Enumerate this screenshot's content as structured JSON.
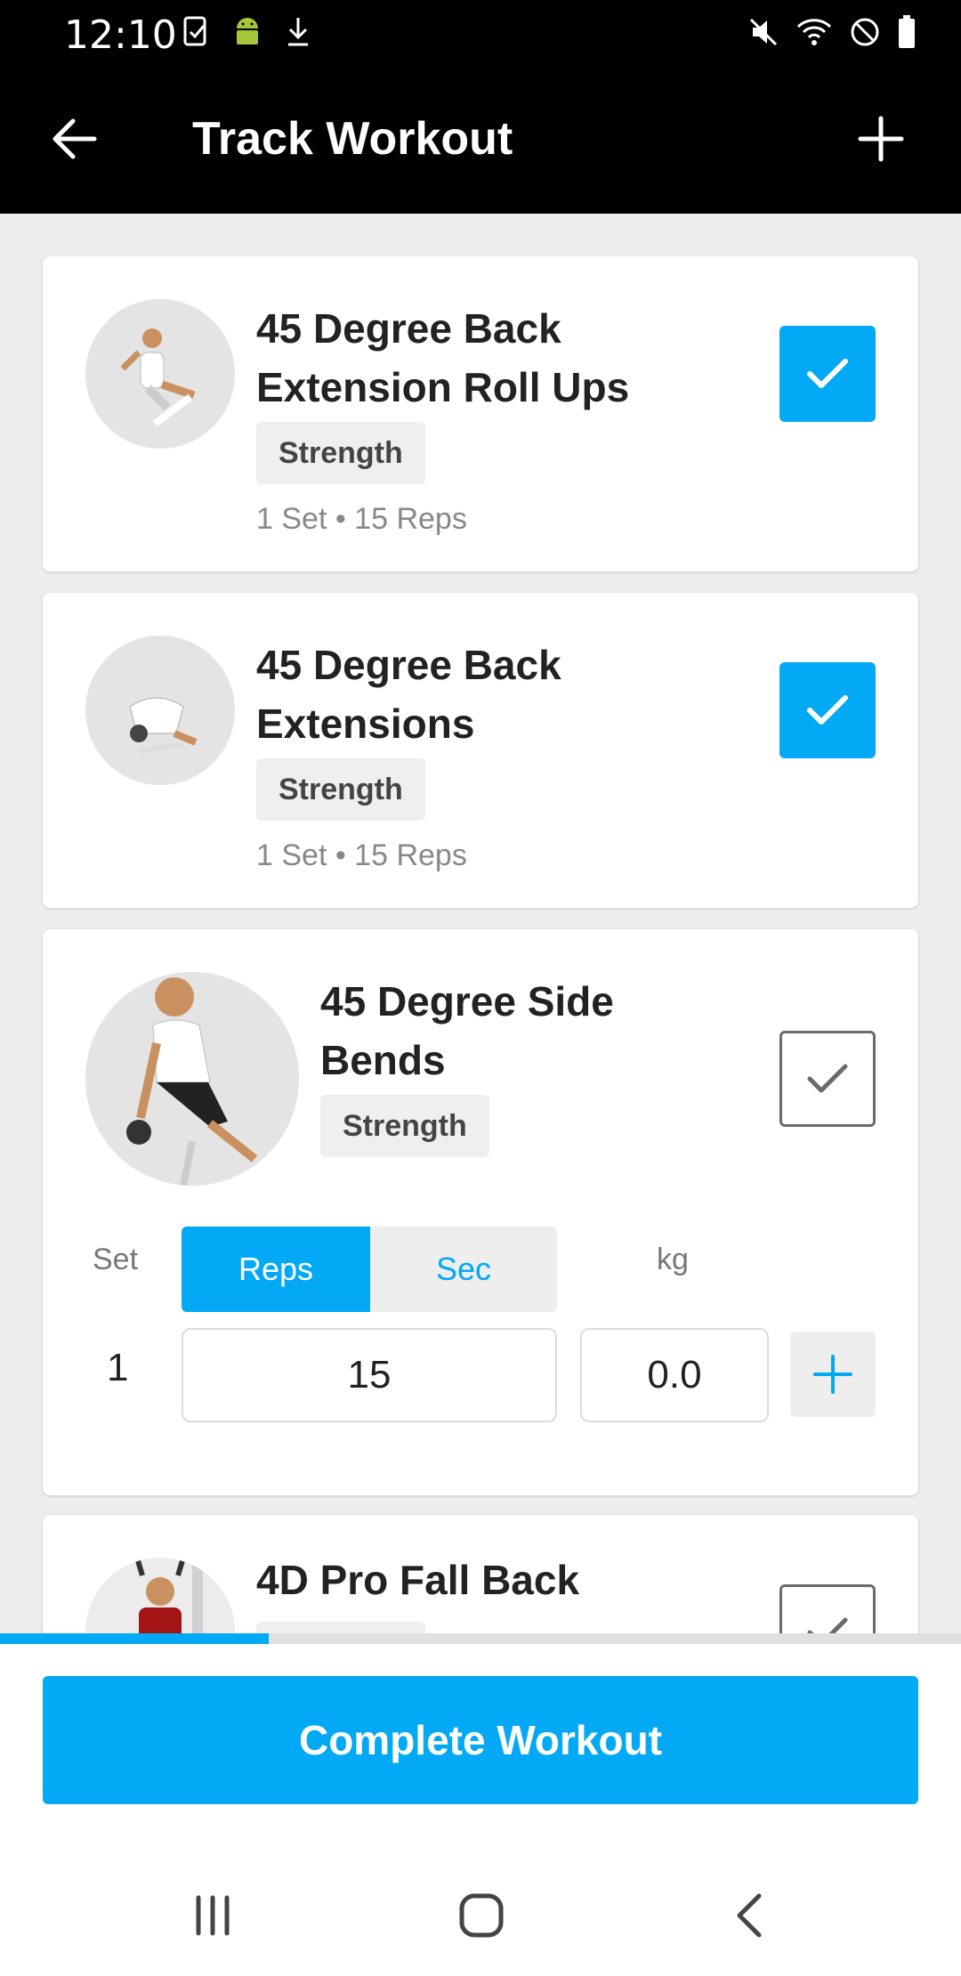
{
  "status_bar": {
    "time": "12:10",
    "left_icons": [
      "checklist-icon",
      "android-icon",
      "download-icon"
    ],
    "right_icons": [
      "mute-icon",
      "wifi-icon",
      "do-not-disturb-icon",
      "battery-icon"
    ]
  },
  "app_bar": {
    "title": "Track Workout",
    "back_icon": "arrow-left-icon",
    "add_icon": "plus-icon"
  },
  "exercises": [
    {
      "name_line1": "45 Degree Back",
      "name_line2": "Extension Roll Ups",
      "tag": "Strength",
      "meta": "1 Set • 15 Reps",
      "checked": true
    },
    {
      "name_line1": "45 Degree Back",
      "name_line2": "Extensions",
      "tag": "Strength",
      "meta": "1 Set • 15 Reps",
      "checked": true
    },
    {
      "name_line1": "45 Degree Side",
      "name_line2": "Bends",
      "tag": "Strength",
      "checked": false,
      "editor": {
        "set_header": "Set",
        "reps_tab": "Reps",
        "sec_tab": "Sec",
        "weight_header": "kg",
        "set_number": "1",
        "reps_value": "15",
        "weight_value": "0.0"
      }
    },
    {
      "name_line1": "4D Pro Fall Back",
      "checked": false
    }
  ],
  "progress": {
    "fraction": 0.28
  },
  "complete_button": "Complete Workout",
  "colors": {
    "accent": "#03a9f4",
    "appbar": "#000000",
    "background": "#eeeeee"
  },
  "nav": {
    "recents_icon": "recents-icon",
    "home_icon": "home-icon",
    "back_icon": "nav-back-icon"
  }
}
